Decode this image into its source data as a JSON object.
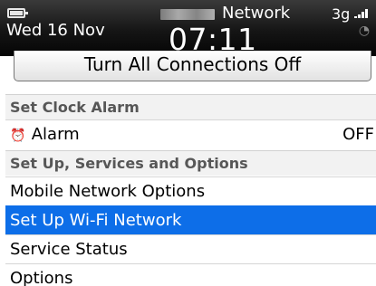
{
  "status_bar": {
    "date": "Wed 16 Nov",
    "time": "07:11",
    "carrier": "Network",
    "network_type": "3g",
    "icons": [
      "battery-icon",
      "signal-icon",
      "wifi-icon"
    ]
  },
  "connections_button": {
    "label": "Turn All Connections Off"
  },
  "clock_alarm": {
    "header": "Set Clock Alarm",
    "alarm": {
      "icon": "alarm-clock-icon",
      "label": "Alarm",
      "value": "OFF"
    }
  },
  "setup": {
    "header": "Set Up, Services and Options",
    "items": [
      {
        "label": "Mobile Network Options"
      },
      {
        "label": "Set Up Wi-Fi Network"
      },
      {
        "label": "Service Status"
      },
      {
        "label": "Options"
      }
    ]
  },
  "colors": {
    "selection": "#0d6ee8",
    "status_bar": "#151515",
    "section_header": "#f2f2f2"
  }
}
